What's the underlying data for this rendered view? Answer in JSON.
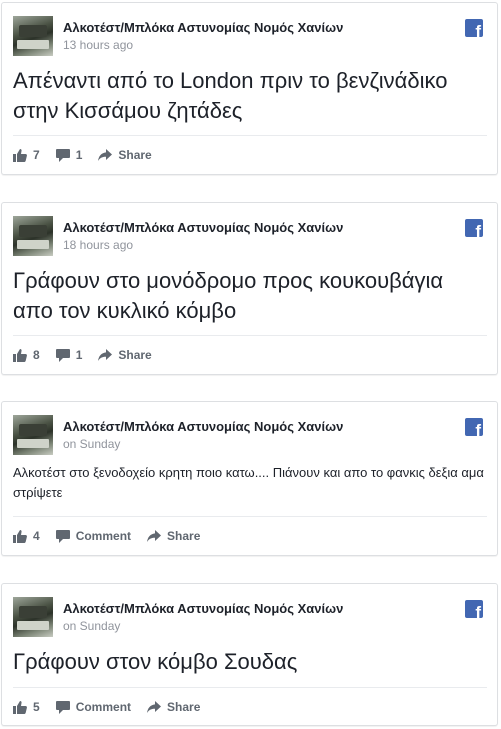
{
  "page_name": "Αλκοτέστ/Μπλόκα Αστυνομίας Νομός Χανίων",
  "icons": {
    "platform": "facebook-icon",
    "like": "thumbs-up-icon",
    "comment": "comment-bubble-icon",
    "share": "share-arrow-icon"
  },
  "colors": {
    "facebook_blue": "#4267b2",
    "meta_gray": "#90949c",
    "action_gray": "#606770",
    "text": "#1d2129"
  },
  "posts": [
    {
      "author": "Αλκοτέστ/Μπλόκα Αστυνομίας Νομός Χανίων",
      "time": "13 hours ago",
      "message": "Απέναντι από το London πριν το βενζινάδικο στην Κισσάμου ζητάδες",
      "likes": "7",
      "comments": "1",
      "share_label": "Share"
    },
    {
      "author": "Αλκοτέστ/Μπλόκα Αστυνομίας Νομός Χανίων",
      "time": "18 hours ago",
      "message": "Γράφουν στο μονόδρομο προς κουκουβάγια απο τον κυκλικό κόμβο",
      "likes": "8",
      "comments": "1",
      "share_label": "Share"
    },
    {
      "author": "Αλκοτέστ/Μπλόκα Αστυνομίας Νομός Χανίων",
      "time": "on Sunday",
      "message": "Αλκοτέστ στο ξενοδοχείο κρητη ποιο κατω.... Πιάνουν και απο το φανκις δεξια αμα στρίψετε",
      "likes": "4",
      "comment_label": "Comment",
      "share_label": "Share"
    },
    {
      "author": "Αλκοτέστ/Μπλόκα Αστυνομίας Νομός Χανίων",
      "time": "on Sunday",
      "message": "Γράφουν στον κόμβο Σουδας",
      "likes": "5",
      "comment_label": "Comment",
      "share_label": "Share"
    }
  ]
}
